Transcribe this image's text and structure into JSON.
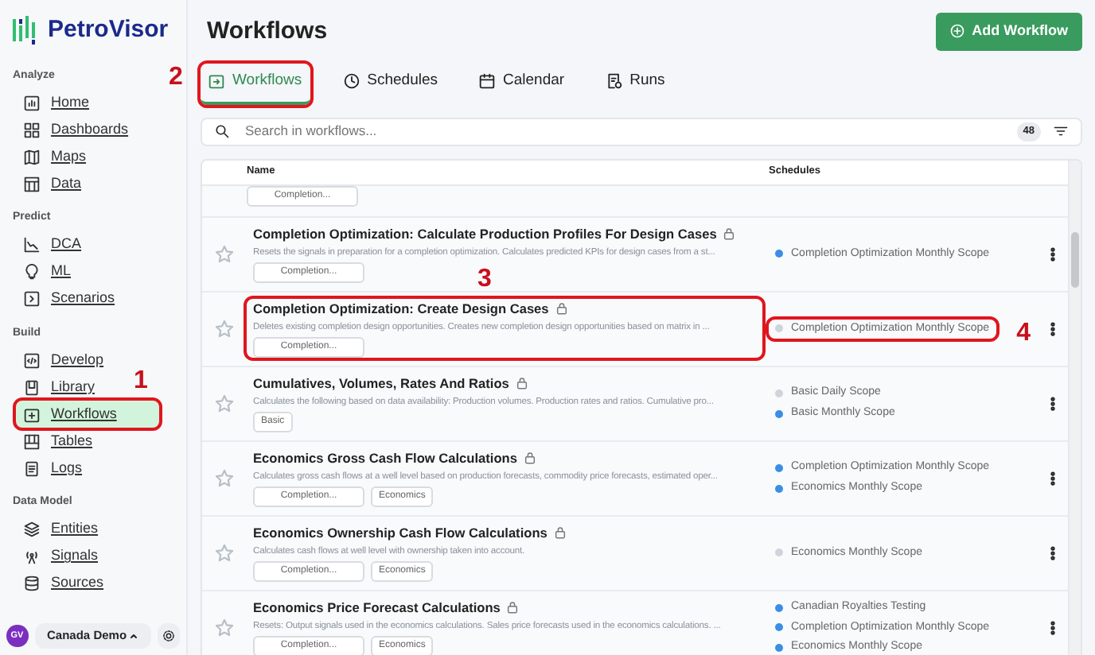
{
  "sidebar": {
    "logo": "PetroVisor",
    "sections": [
      {
        "label": "Analyze",
        "items": [
          {
            "label": "Home",
            "selected": false
          },
          {
            "label": "Dashboards",
            "selected": false
          },
          {
            "label": "Maps",
            "selected": false
          },
          {
            "label": "Data",
            "selected": false
          }
        ]
      },
      {
        "label": "Predict",
        "items": [
          {
            "label": "DCA",
            "selected": false
          },
          {
            "label": "ML",
            "selected": false
          },
          {
            "label": "Scenarios",
            "selected": false
          }
        ]
      },
      {
        "label": "Build",
        "items": [
          {
            "label": "Develop",
            "selected": false
          },
          {
            "label": "Library",
            "selected": false
          },
          {
            "label": "Workflows",
            "selected": true,
            "callout": "1"
          },
          {
            "label": "Tables",
            "selected": false
          },
          {
            "label": "Logs",
            "selected": false
          }
        ]
      },
      {
        "label": "Data Model",
        "items": [
          {
            "label": "Entities",
            "selected": false
          },
          {
            "label": "Signals",
            "selected": false
          },
          {
            "label": "Sources",
            "selected": false
          }
        ]
      }
    ],
    "user": {
      "initials": "GV",
      "workspace": "Canada Demo"
    }
  },
  "page": {
    "title": "Workflows",
    "add_button": "Add Workflow"
  },
  "tabs": [
    {
      "label": "Workflows",
      "selected": true,
      "callout": "2"
    },
    {
      "label": "Schedules",
      "selected": false
    },
    {
      "label": "Calendar",
      "selected": false
    },
    {
      "label": "Runs",
      "selected": false
    }
  ],
  "search": {
    "placeholder": "Search in workflows...",
    "count": "48"
  },
  "table": {
    "columns": [
      "Name",
      "Schedules"
    ],
    "rows": [
      {
        "tags": [
          "Completion..."
        ],
        "schedules": []
      },
      {
        "title": "Completion Optimization: Calculate Production Profiles For Design Cases",
        "locked": true,
        "favorite": false,
        "description": "Resets the signals in preparation for a completion optimization. Calculates predicted KPIs for design cases from a st...",
        "tags": [
          "Completion..."
        ],
        "schedules": [
          {
            "name": "Completion Optimization Monthly Scope",
            "color": "#3b8ee6"
          }
        ]
      },
      {
        "title": "Completion Optimization: Create Design Cases",
        "locked": true,
        "favorite": false,
        "description": "Deletes existing completion design opportunities. Creates new completion design opportunities based on matrix in ...",
        "tags": [
          "Completion..."
        ],
        "callout": "3",
        "schedules": [
          {
            "name": "Completion Optimization Monthly Scope",
            "color": "#ced4da",
            "callout": "4"
          }
        ]
      },
      {
        "title": "Cumulatives, Volumes, Rates And Ratios",
        "locked": true,
        "favorite": false,
        "description": "Calculates the following based on data availability: Production volumes. Production rates and ratios. Cumulative pro...",
        "tags": [
          "Basic"
        ],
        "schedules": [
          {
            "name": "Basic Daily Scope",
            "color": "#ced4da"
          },
          {
            "name": "Basic Monthly Scope",
            "color": "#3b8ee6"
          }
        ]
      },
      {
        "title": "Economics Gross Cash Flow Calculations",
        "locked": true,
        "favorite": false,
        "description": "Calculates gross cash flows at a well level based on production forecasts, commodity price forecasts, estimated oper...",
        "tags": [
          "Completion...",
          "Economics"
        ],
        "schedules": [
          {
            "name": "Completion Optimization Monthly Scope",
            "color": "#3b8ee6"
          },
          {
            "name": "Economics Monthly Scope",
            "color": "#3b8ee6"
          }
        ]
      },
      {
        "title": "Economics Ownership Cash Flow Calculations",
        "locked": true,
        "favorite": false,
        "description": "Calculates cash flows at well level with ownership taken into account.",
        "tags": [
          "Completion...",
          "Economics"
        ],
        "schedules": [
          {
            "name": "Economics Monthly Scope",
            "color": "#ced4da"
          }
        ]
      },
      {
        "title": "Economics Price Forecast Calculations",
        "locked": true,
        "favorite": false,
        "description": "Resets: Output signals used in the economics calculations. Sales price forecasts used in the economics calculations. ...",
        "tags": [
          "Completion...",
          "Economics"
        ],
        "schedules": [
          {
            "name": "Canadian Royalties Testing",
            "color": "#3b8ee6"
          },
          {
            "name": "Completion Optimization Monthly Scope",
            "color": "#3b8ee6"
          },
          {
            "name": "Economics Monthly Scope",
            "color": "#3b8ee6"
          }
        ]
      }
    ]
  }
}
